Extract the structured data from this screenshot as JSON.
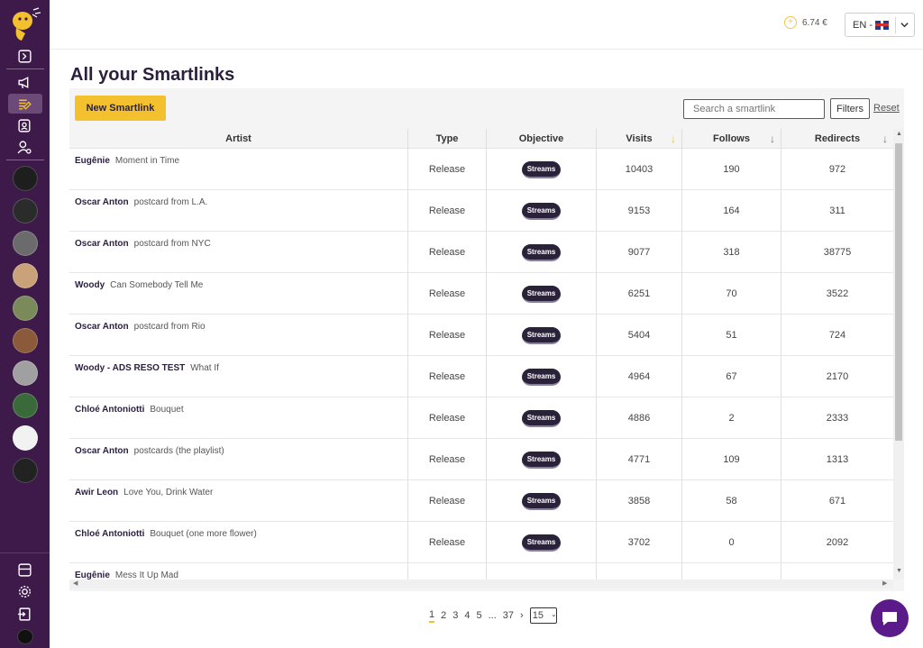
{
  "topbar": {
    "balance": "6.74 €",
    "language": "EN -"
  },
  "page": {
    "title": "All your Smartlinks"
  },
  "toolbar": {
    "new_label": "New Smartlink",
    "search_placeholder": "Search a smartlink",
    "filters_label": "Filters",
    "reset_label": "Reset"
  },
  "table": {
    "headers": [
      "Artist",
      "Type",
      "Objective",
      "Visits",
      "Follows",
      "Redirects"
    ],
    "rows": [
      {
        "artist": "Eugênie",
        "title": "Moment in Time",
        "type": "Release",
        "objective": "Streams",
        "visits": "10403",
        "follows": "190",
        "redirects": "972"
      },
      {
        "artist": "Oscar Anton",
        "title": "postcard from L.A.",
        "type": "Release",
        "objective": "Streams",
        "visits": "9153",
        "follows": "164",
        "redirects": "311"
      },
      {
        "artist": "Oscar Anton",
        "title": "postcard from NYC",
        "type": "Release",
        "objective": "Streams",
        "visits": "9077",
        "follows": "318",
        "redirects": "38775"
      },
      {
        "artist": "Woody",
        "title": "Can Somebody Tell Me",
        "type": "Release",
        "objective": "Streams",
        "visits": "6251",
        "follows": "70",
        "redirects": "3522"
      },
      {
        "artist": "Oscar Anton",
        "title": "postcard from Rio",
        "type": "Release",
        "objective": "Streams",
        "visits": "5404",
        "follows": "51",
        "redirects": "724"
      },
      {
        "artist": "Woody - ADS RESO TEST",
        "title": "What If",
        "type": "Release",
        "objective": "Streams",
        "visits": "4964",
        "follows": "67",
        "redirects": "2170"
      },
      {
        "artist": "Chloé Antoniotti",
        "title": "Bouquet",
        "type": "Release",
        "objective": "Streams",
        "visits": "4886",
        "follows": "2",
        "redirects": "2333"
      },
      {
        "artist": "Oscar Anton",
        "title": "postcards (the playlist)",
        "type": "Release",
        "objective": "Streams",
        "visits": "4771",
        "follows": "109",
        "redirects": "1313"
      },
      {
        "artist": "Awir Leon",
        "title": "Love You, Drink Water",
        "type": "Release",
        "objective": "Streams",
        "visits": "3858",
        "follows": "58",
        "redirects": "671"
      },
      {
        "artist": "Chloé Antoniotti",
        "title": "Bouquet (one more flower)",
        "type": "Release",
        "objective": "Streams",
        "visits": "3702",
        "follows": "0",
        "redirects": "2092"
      },
      {
        "artist": "Eugênie",
        "title": "Mess It Up Mad",
        "type": "",
        "objective": "",
        "visits": "",
        "follows": "",
        "redirects": ""
      }
    ]
  },
  "pagination": {
    "pages": [
      "1",
      "2",
      "3",
      "4",
      "5"
    ],
    "ellipsis": "...",
    "last": "37",
    "next": "›",
    "per_page": "15"
  },
  "colors": {
    "sidebar": "#3d1a4a",
    "accent": "#f3c12e",
    "pill": "#2a2238",
    "chat": "#5b1a8a"
  },
  "avatars": [
    "#1e1e1e",
    "#2b2b2b",
    "#6b6b6b",
    "#c9a27a",
    "#7a8a5a",
    "#8a5a3a",
    "#a0a0a0",
    "#3a6a3a",
    "#f2f2f2",
    "#222222"
  ]
}
